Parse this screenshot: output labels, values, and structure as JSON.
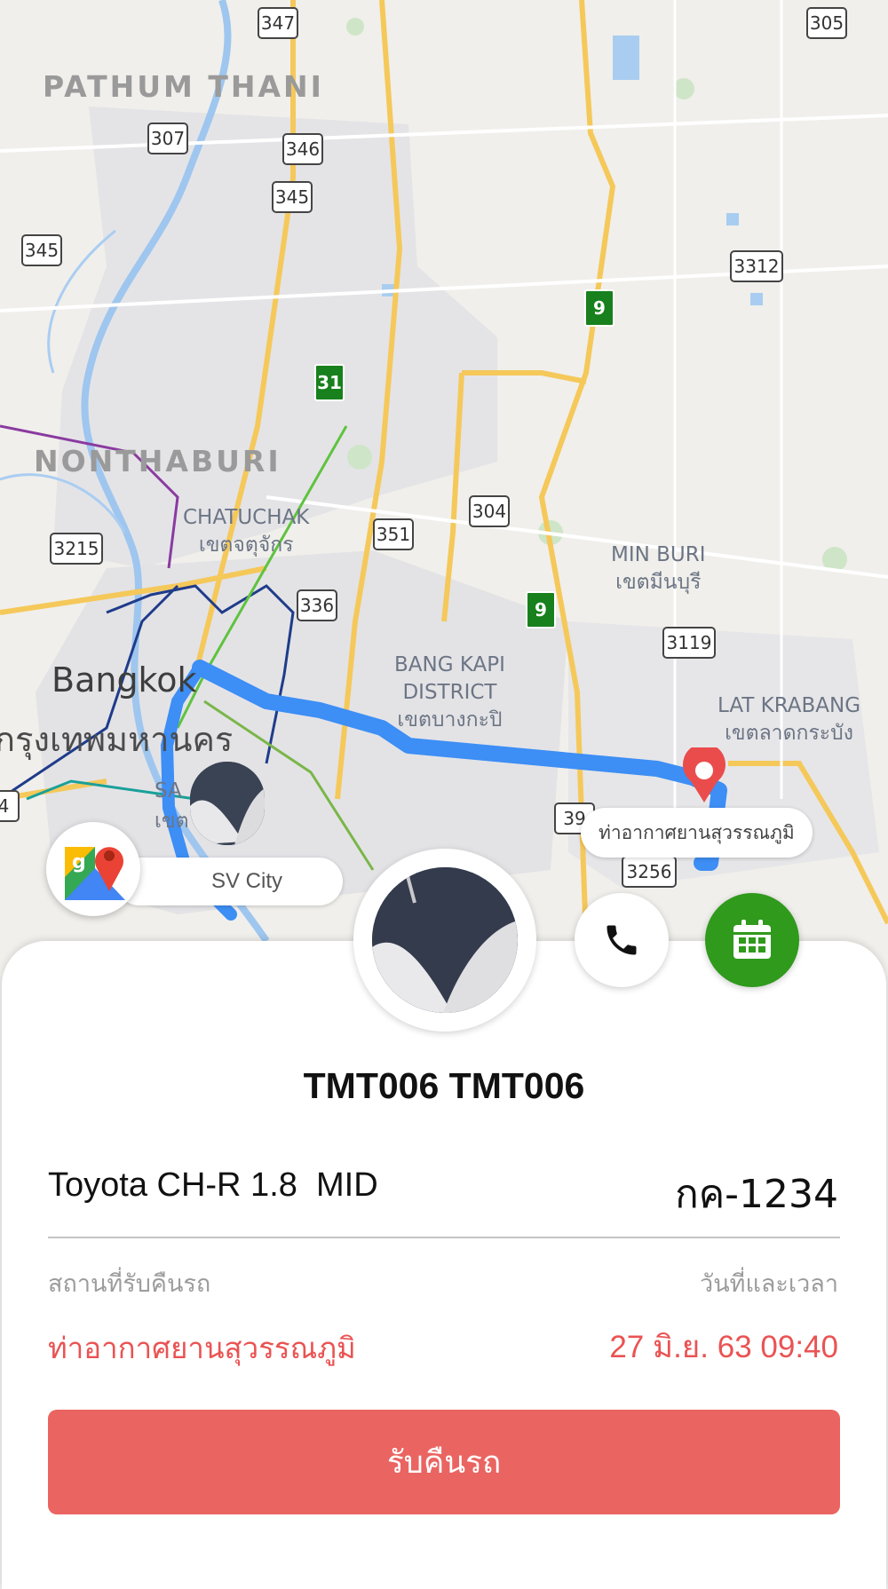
{
  "map": {
    "region_labels": [
      "PATHUM THANI",
      "NONTHABURI"
    ],
    "city_label": "Bangkok",
    "city_label_th": "กรุงเทพมหานคร",
    "districts": [
      {
        "en": "CHATUCHAK",
        "th": "เขตจตุจักร"
      },
      {
        "en": "MIN BURI",
        "th": "เขตมีนบุรี"
      },
      {
        "en": "BANG KAPI",
        "en2": "DISTRICT",
        "th": "เขตบางกะปิ"
      },
      {
        "en": "LAT KRABANG",
        "th": "เขตลาดกระบัง"
      }
    ],
    "partial_labels": [
      "SA",
      "เขต"
    ],
    "route_shields": [
      "347",
      "305",
      "307",
      "346",
      "345",
      "345",
      "3312",
      "3215",
      "351",
      "304",
      "336",
      "3119",
      "39",
      "3256",
      "4"
    ],
    "highway_shields": [
      "9",
      "31",
      "9"
    ],
    "origin_label": "SV City",
    "destination_label": "ท่าอากาศยานสุวรรณภูมิ",
    "icons": [
      "google-maps-icon",
      "destination-pin-icon",
      "driver-marker-icon"
    ],
    "colors": {
      "route": "#3d8ef5",
      "pin": "#ea4c4c"
    }
  },
  "actions": {
    "call_icon": "phone-icon",
    "calendar_icon": "calendar-icon",
    "calendar_color": "#2f9a1c"
  },
  "booking": {
    "driver_name": "TMT006 TMT006",
    "car_model": "Toyota CH-R 1.8  MID",
    "plate": "กค-1234",
    "location_label": "สถานที่รับคืนรถ",
    "datetime_label": "วันที่และเวลา",
    "location_value": "ท่าอากาศยานสุวรรณภูมิ",
    "datetime_value": "27 มิ.ย. 63 09:40",
    "primary_button": "รับคืนรถ",
    "accent_color": "#ea5353"
  }
}
